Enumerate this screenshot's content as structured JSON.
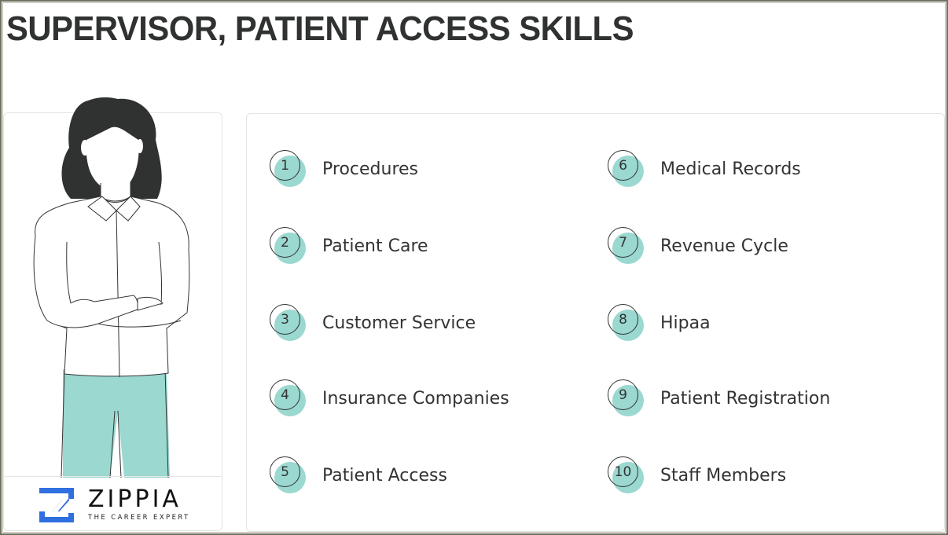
{
  "title": "SUPERVISOR, PATIENT ACCESS SKILLS",
  "brand": {
    "name": "ZIPPIA",
    "tagline": "THE CAREER EXPERT",
    "color": "#2f6fe0"
  },
  "accent_color": "#9ad8d0",
  "illustration": "woman-arms-crossed",
  "skills": [
    {
      "num": "1",
      "label": "Procedures"
    },
    {
      "num": "2",
      "label": "Patient Care"
    },
    {
      "num": "3",
      "label": "Customer Service"
    },
    {
      "num": "4",
      "label": "Insurance Companies"
    },
    {
      "num": "5",
      "label": "Patient Access"
    },
    {
      "num": "6",
      "label": "Medical Records"
    },
    {
      "num": "7",
      "label": "Revenue Cycle"
    },
    {
      "num": "8",
      "label": "Hipaa"
    },
    {
      "num": "9",
      "label": "Patient Registration"
    },
    {
      "num": "10",
      "label": "Staff Members"
    }
  ]
}
